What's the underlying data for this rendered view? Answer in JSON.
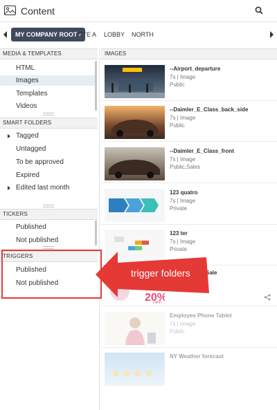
{
  "header": {
    "title": "Content",
    "app_icon": "image-gallery-icon",
    "search_icon": "search-icon"
  },
  "tabs": {
    "items": [
      "MY COMPANY ROOT",
      "SITE A",
      "LOBBY",
      "NORTH"
    ],
    "active": "MY COMPANY ROOT"
  },
  "left": {
    "media": {
      "header": "MEDIA & TEMPLATES",
      "items": [
        "HTML",
        "Images",
        "Templates",
        "Videos"
      ],
      "selected": "Images"
    },
    "smart": {
      "header": "SMART FOLDERS",
      "items": [
        "Tagged",
        "Untagged",
        "To be approved",
        "Expired",
        "Edited last month"
      ]
    },
    "tickers": {
      "header": "TICKERS",
      "items": [
        "Published",
        "Not published"
      ]
    },
    "triggers": {
      "header": "TRIGGERS",
      "items": [
        "Published",
        "Not published"
      ]
    }
  },
  "images": {
    "header": "IMAGES",
    "cards": [
      {
        "name": "--Airport_departure",
        "duration": "7s | Image",
        "tags": "Public"
      },
      {
        "name": "--Daimler_E_Class_back_side",
        "duration": "7s | Image",
        "tags": "Public"
      },
      {
        "name": "--Daimler_E_Class_front",
        "duration": "7s | Image",
        "tags": "Public,Sales"
      },
      {
        "name": "123 quatro",
        "duration": "7s | Image",
        "tags": "Private"
      },
      {
        "name": "123 ter",
        "duration": "7s | Image",
        "tags": "Private"
      },
      {
        "name": "Sale",
        "duration": "",
        "tags": ""
      },
      {
        "name": "Employee Phone Tablet",
        "duration": "7s | Image",
        "tags": "Public"
      },
      {
        "name": "NY Weather forecast",
        "duration": "7s | Image",
        "tags": ""
      }
    ]
  },
  "annotation": {
    "text": "trigger folders",
    "color": "#e53935"
  }
}
